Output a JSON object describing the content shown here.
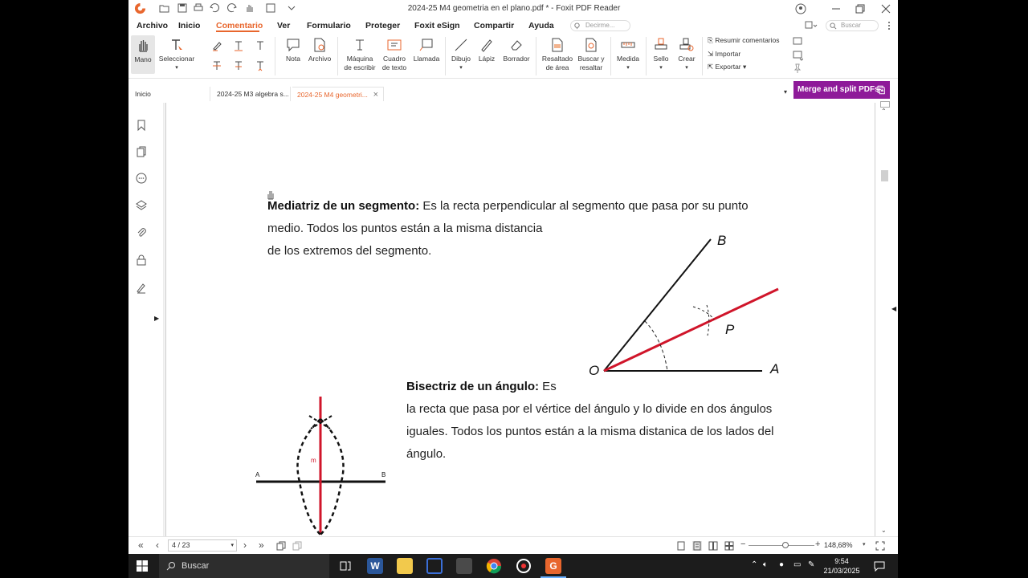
{
  "window": {
    "title": "2024-25 M4 geometria en el plano.pdf * - Foxit PDF Reader"
  },
  "menu": {
    "items": [
      "Archivo",
      "Inicio",
      "Comentario",
      "Ver",
      "Formulario",
      "Proteger",
      "Foxit eSign",
      "Compartir",
      "Ayuda"
    ],
    "active": "Comentario",
    "tell_me_placeholder": "Decirme...",
    "search_placeholder": "Buscar"
  },
  "ribbon": {
    "mano": "Mano",
    "seleccionar": "Seleccionar",
    "nota": "Nota",
    "archivo": "Archivo",
    "maquina_1": "Máquina",
    "maquina_2": "de escribir",
    "cuadro_1": "Cuadro",
    "cuadro_2": "de texto",
    "llamada": "Llamada",
    "dibujo": "Dibujo",
    "lapiz": "Lápiz",
    "borrador": "Borrador",
    "resaltado_1": "Resaltado",
    "resaltado_2": "de área",
    "buscar_1": "Buscar y",
    "buscar_2": "resaltar",
    "medida": "Medida",
    "sello": "Sello",
    "crear": "Crear",
    "resumir": "Resumir comentarios",
    "importar": "Importar",
    "exportar": "Exportar"
  },
  "tabs": {
    "tab1": "Inicio",
    "tab2": "2024-25 M3 algebra s...",
    "tab3": "2024-25 M4 geometri..."
  },
  "promo": "Merge and split PDFs",
  "document": {
    "mediatriz_title": "Mediatriz de un segmento:",
    "mediatriz_line1": " Es la recta perpendicular al segmento que pasa por su punto",
    "mediatriz_line2": "medio. Todos los puntos están a la misma distancia",
    "mediatriz_line3": "de los extremos del segmento.",
    "bisectriz_title": "Bisectriz de un ángulo:",
    "bisectriz_line0": " Es",
    "bisectriz_line1": "la recta que pasa por el vértice del ángulo y lo divide en dos ángulos",
    "bisectriz_line2": "iguales. Todos los puntos están a la misma distanica de los lados del",
    "bisectriz_line3": "ángulo.",
    "angle_labels": {
      "O": "O",
      "A": "A",
      "B": "B",
      "P": "P"
    },
    "segment_labels": {
      "A": "A",
      "B": "B",
      "m": "m"
    }
  },
  "statusbar": {
    "page": "4 / 23",
    "zoom": "148,68%"
  },
  "taskbar": {
    "search": "Buscar",
    "time": "9:54",
    "date": "21/03/2025"
  },
  "colors": {
    "accent": "#e8662d",
    "promo": "#8e1a99",
    "bisector": "#d0152a"
  }
}
